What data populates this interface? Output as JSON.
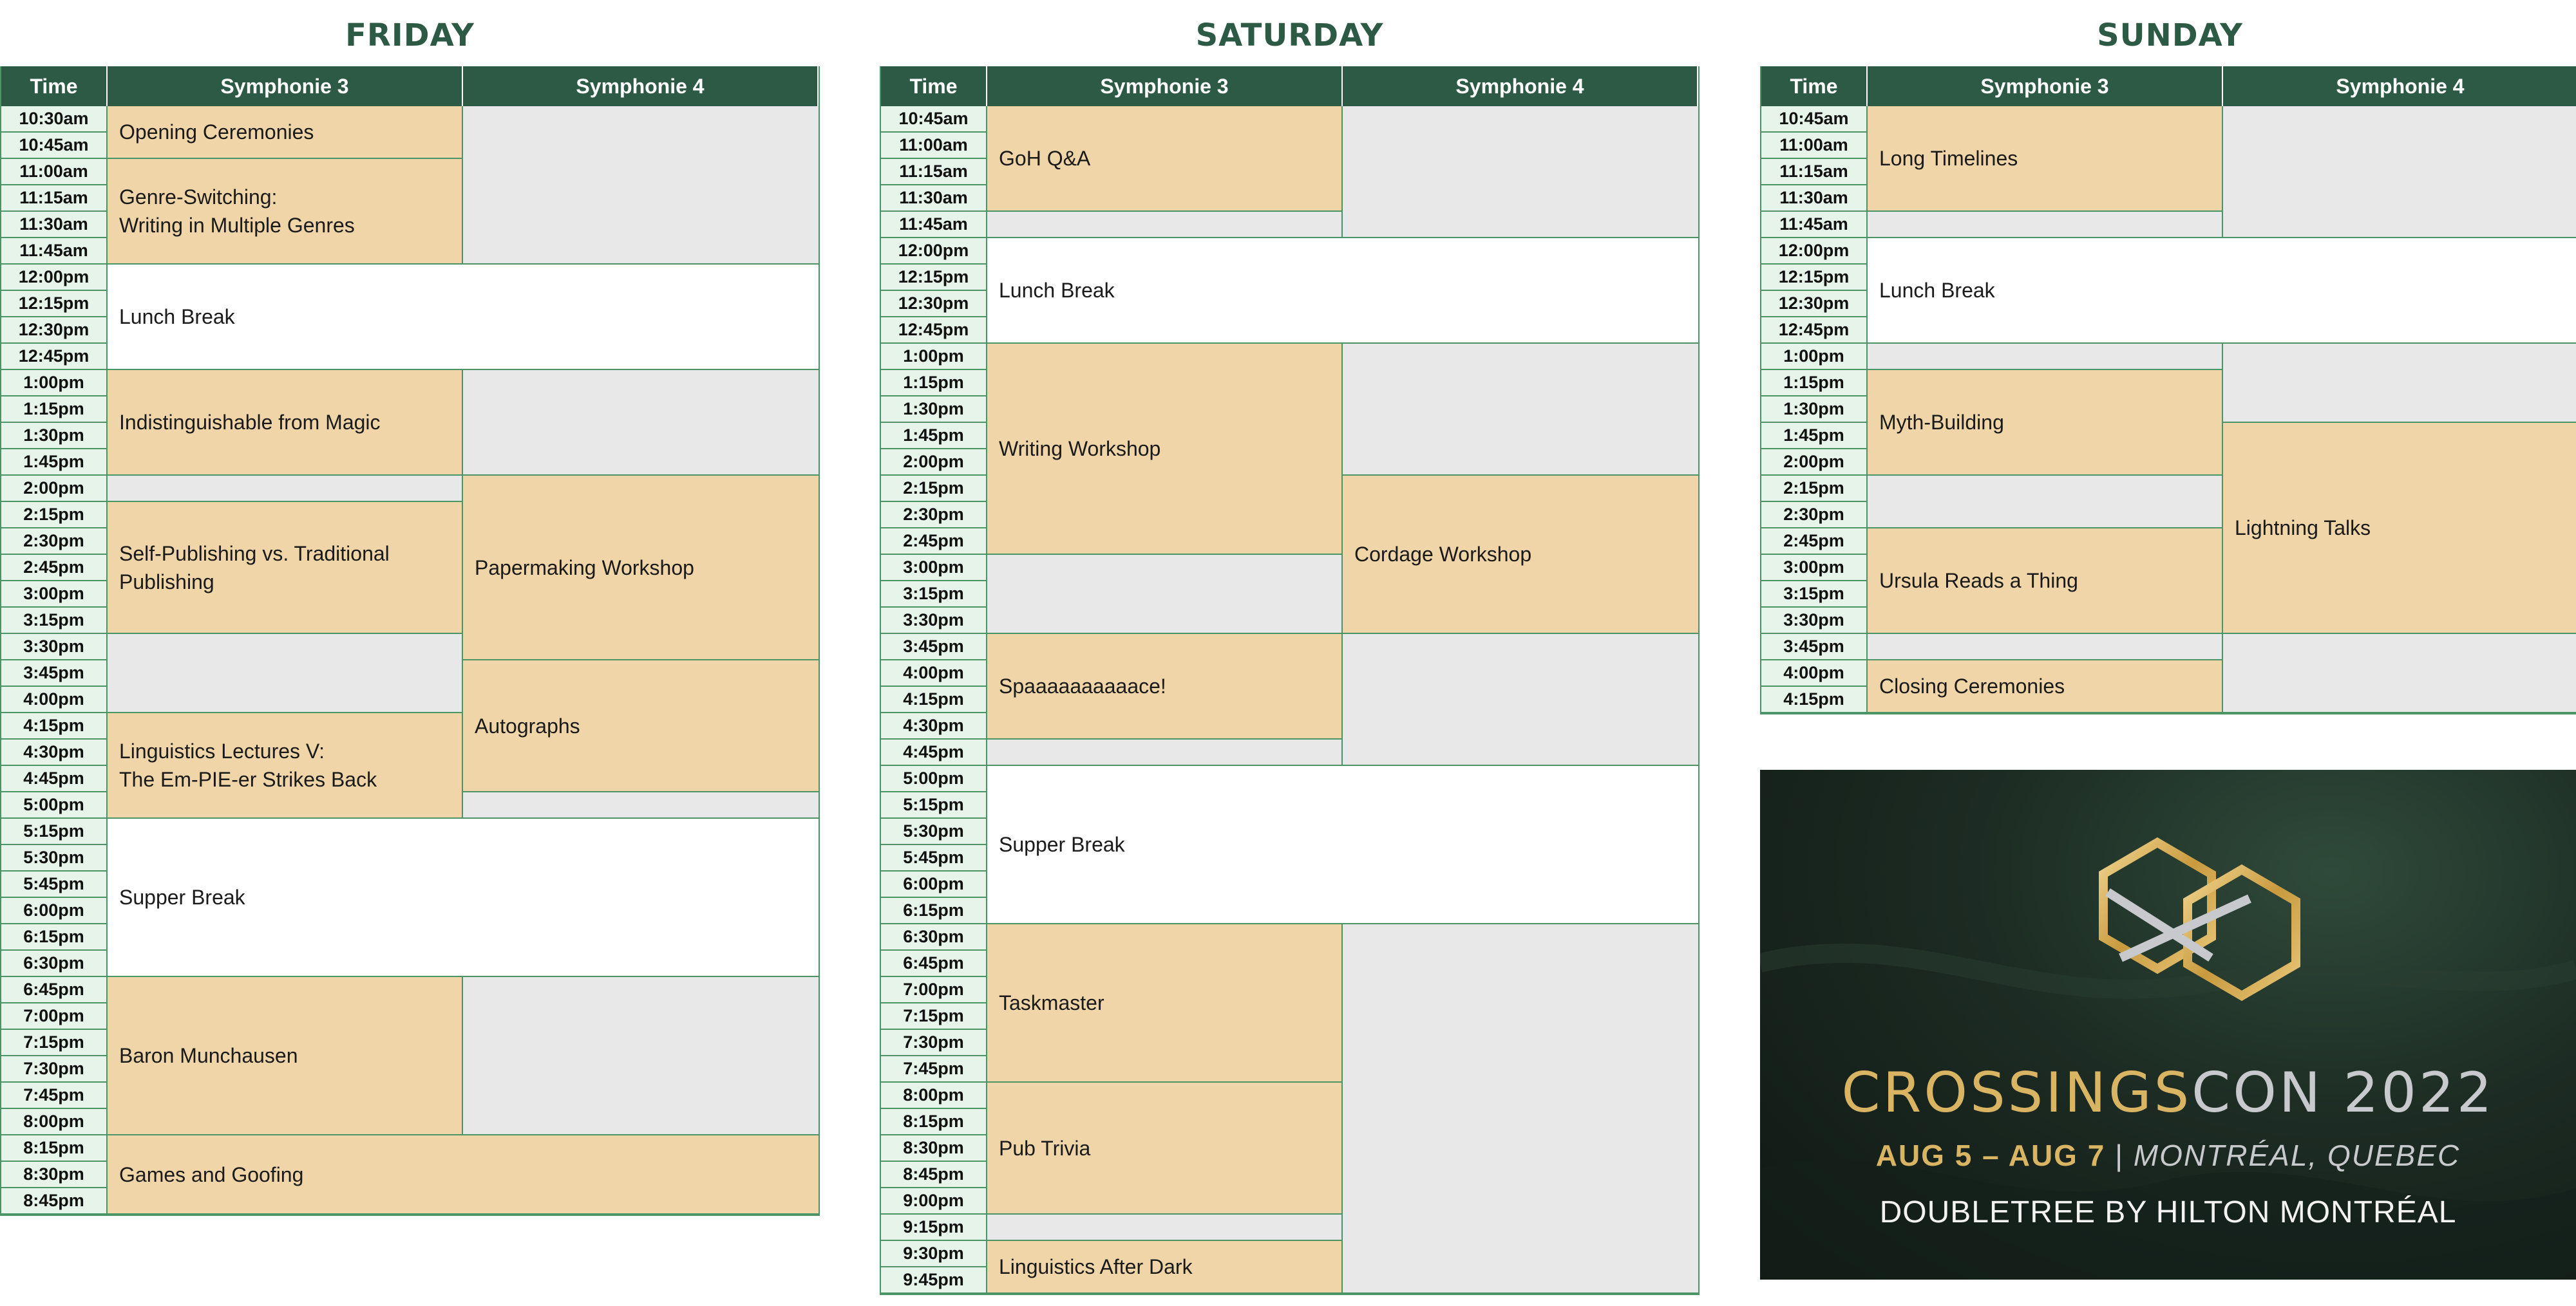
{
  "headers": {
    "time": "Time",
    "room_a": "Symphonie 3",
    "room_b": "Symphonie 4"
  },
  "days": [
    {
      "title": "FRIDAY",
      "times": [
        "10:30am",
        "10:45am",
        "11:00am",
        "11:15am",
        "11:30am",
        "11:45am",
        "12:00pm",
        "12:15pm",
        "12:30pm",
        "12:45pm",
        "1:00pm",
        "1:15pm",
        "1:30pm",
        "1:45pm",
        "2:00pm",
        "2:15pm",
        "2:30pm",
        "2:45pm",
        "3:00pm",
        "3:15pm",
        "3:30pm",
        "3:45pm",
        "4:00pm",
        "4:15pm",
        "4:30pm",
        "4:45pm",
        "5:00pm",
        "5:15pm",
        "5:30pm",
        "5:45pm",
        "6:00pm",
        "6:15pm",
        "6:30pm",
        "6:45pm",
        "7:00pm",
        "7:15pm",
        "7:30pm",
        "7:45pm",
        "8:00pm",
        "8:15pm",
        "8:30pm",
        "8:45pm"
      ],
      "events": [
        {
          "col": "a",
          "start": 0,
          "span": 2,
          "title": "Opening Ceremonies",
          "kind": "session"
        },
        {
          "col": "a",
          "start": 2,
          "span": 4,
          "title": "Genre-Switching:\nWriting in Multiple Genres",
          "kind": "session"
        },
        {
          "col": "b",
          "start": 0,
          "span": 6,
          "title": "",
          "kind": "empty"
        },
        {
          "col": "ab",
          "start": 6,
          "span": 4,
          "title": "Lunch Break",
          "kind": "break"
        },
        {
          "col": "a",
          "start": 10,
          "span": 4,
          "title": "Indistinguishable from Magic",
          "kind": "session"
        },
        {
          "col": "b",
          "start": 10,
          "span": 4,
          "title": "",
          "kind": "empty"
        },
        {
          "col": "a",
          "start": 14,
          "span": 1,
          "title": "",
          "kind": "empty"
        },
        {
          "col": "a",
          "start": 15,
          "span": 5,
          "title": "Self-Publishing vs. Traditional\nPublishing",
          "kind": "session"
        },
        {
          "col": "b",
          "start": 14,
          "span": 7,
          "title": "Papermaking Workshop",
          "kind": "session"
        },
        {
          "col": "a",
          "start": 20,
          "span": 3,
          "title": "",
          "kind": "empty"
        },
        {
          "col": "a",
          "start": 23,
          "span": 4,
          "title": "Linguistics Lectures V:\nThe Em-PIE-er Strikes Back",
          "kind": "session"
        },
        {
          "col": "b",
          "start": 21,
          "span": 5,
          "title": "Autographs",
          "kind": "session"
        },
        {
          "col": "b",
          "start": 26,
          "span": 1,
          "title": "",
          "kind": "empty"
        },
        {
          "col": "ab",
          "start": 27,
          "span": 6,
          "title": "Supper Break",
          "kind": "break"
        },
        {
          "col": "a",
          "start": 33,
          "span": 6,
          "title": "Baron Munchausen",
          "kind": "session"
        },
        {
          "col": "b",
          "start": 33,
          "span": 6,
          "title": "",
          "kind": "empty"
        },
        {
          "col": "ab",
          "start": 39,
          "span": 3,
          "title": "Games and Goofing",
          "kind": "session"
        }
      ]
    },
    {
      "title": "SATURDAY",
      "times": [
        "10:45am",
        "11:00am",
        "11:15am",
        "11:30am",
        "11:45am",
        "12:00pm",
        "12:15pm",
        "12:30pm",
        "12:45pm",
        "1:00pm",
        "1:15pm",
        "1:30pm",
        "1:45pm",
        "2:00pm",
        "2:15pm",
        "2:30pm",
        "2:45pm",
        "3:00pm",
        "3:15pm",
        "3:30pm",
        "3:45pm",
        "4:00pm",
        "4:15pm",
        "4:30pm",
        "4:45pm",
        "5:00pm",
        "5:15pm",
        "5:30pm",
        "5:45pm",
        "6:00pm",
        "6:15pm",
        "6:30pm",
        "6:45pm",
        "7:00pm",
        "7:15pm",
        "7:30pm",
        "7:45pm",
        "8:00pm",
        "8:15pm",
        "8:30pm",
        "8:45pm",
        "9:00pm",
        "9:15pm",
        "9:30pm",
        "9:45pm"
      ],
      "events": [
        {
          "col": "a",
          "start": 0,
          "span": 4,
          "title": "GoH Q&A",
          "kind": "session"
        },
        {
          "col": "a",
          "start": 4,
          "span": 1,
          "title": "",
          "kind": "empty"
        },
        {
          "col": "b",
          "start": 0,
          "span": 5,
          "title": "",
          "kind": "empty"
        },
        {
          "col": "ab",
          "start": 5,
          "span": 4,
          "title": "Lunch Break",
          "kind": "break"
        },
        {
          "col": "a",
          "start": 9,
          "span": 8,
          "title": "Writing Workshop",
          "kind": "session"
        },
        {
          "col": "b",
          "start": 9,
          "span": 5,
          "title": "",
          "kind": "empty"
        },
        {
          "col": "b",
          "start": 14,
          "span": 6,
          "title": "Cordage Workshop",
          "kind": "session"
        },
        {
          "col": "a",
          "start": 17,
          "span": 3,
          "title": "",
          "kind": "empty"
        },
        {
          "col": "a",
          "start": 20,
          "span": 4,
          "title": "Spaaaaaaaaaace!",
          "kind": "session"
        },
        {
          "col": "a",
          "start": 24,
          "span": 1,
          "title": "",
          "kind": "empty"
        },
        {
          "col": "b",
          "start": 20,
          "span": 5,
          "title": "",
          "kind": "empty"
        },
        {
          "col": "ab",
          "start": 25,
          "span": 6,
          "title": "Supper Break",
          "kind": "break"
        },
        {
          "col": "a",
          "start": 31,
          "span": 6,
          "title": "Taskmaster",
          "kind": "session"
        },
        {
          "col": "a",
          "start": 37,
          "span": 5,
          "title": "Pub Trivia",
          "kind": "session"
        },
        {
          "col": "a",
          "start": 42,
          "span": 1,
          "title": "",
          "kind": "empty"
        },
        {
          "col": "a",
          "start": 43,
          "span": 2,
          "title": "Linguistics After Dark",
          "kind": "session"
        },
        {
          "col": "b",
          "start": 31,
          "span": 14,
          "title": "",
          "kind": "empty"
        }
      ]
    },
    {
      "title": "SUNDAY",
      "times": [
        "10:45am",
        "11:00am",
        "11:15am",
        "11:30am",
        "11:45am",
        "12:00pm",
        "12:15pm",
        "12:30pm",
        "12:45pm",
        "1:00pm",
        "1:15pm",
        "1:30pm",
        "1:45pm",
        "2:00pm",
        "2:15pm",
        "2:30pm",
        "2:45pm",
        "3:00pm",
        "3:15pm",
        "3:30pm",
        "3:45pm",
        "4:00pm",
        "4:15pm"
      ],
      "events": [
        {
          "col": "a",
          "start": 0,
          "span": 4,
          "title": "Long Timelines",
          "kind": "session"
        },
        {
          "col": "a",
          "start": 4,
          "span": 1,
          "title": "",
          "kind": "empty"
        },
        {
          "col": "b",
          "start": 0,
          "span": 5,
          "title": "",
          "kind": "empty"
        },
        {
          "col": "ab",
          "start": 5,
          "span": 4,
          "title": "Lunch Break",
          "kind": "break"
        },
        {
          "col": "a",
          "start": 9,
          "span": 1,
          "title": "",
          "kind": "empty"
        },
        {
          "col": "a",
          "start": 10,
          "span": 4,
          "title": "Myth-Building",
          "kind": "session"
        },
        {
          "col": "a",
          "start": 14,
          "span": 2,
          "title": "",
          "kind": "empty"
        },
        {
          "col": "a",
          "start": 16,
          "span": 4,
          "title": "Ursula Reads a Thing",
          "kind": "session"
        },
        {
          "col": "a",
          "start": 20,
          "span": 1,
          "title": "",
          "kind": "empty"
        },
        {
          "col": "a",
          "start": 21,
          "span": 2,
          "title": "Closing Ceremonies",
          "kind": "session"
        },
        {
          "col": "b",
          "start": 9,
          "span": 3,
          "title": "",
          "kind": "empty"
        },
        {
          "col": "b",
          "start": 12,
          "span": 8,
          "title": "Lightning Talks",
          "kind": "session"
        },
        {
          "col": "b",
          "start": 20,
          "span": 3,
          "title": "",
          "kind": "empty"
        }
      ]
    }
  ],
  "banner": {
    "name_part1": "CR",
    "name_o": "O",
    "name_part2": "SSINGS",
    "name_part3": "CON 2022",
    "dates": "AUG 5 – AUG 7",
    "separator": "|",
    "location": "MONTRÉAL, QUEBEC",
    "venue": "DOUBLETREE BY HILTON MONTRÉAL",
    "logo_icon": "interlocking-hexagons-icon",
    "colors": {
      "gold": "#d9b463",
      "silver": "#c7c9cc",
      "green_dark": "#1c2b23"
    }
  },
  "colors": {
    "header": "#2d5a45",
    "session": "#f0d5a8",
    "empty": "#e8e8e8",
    "time_bg": "#e6f4ea",
    "border": "#4a9466"
  }
}
